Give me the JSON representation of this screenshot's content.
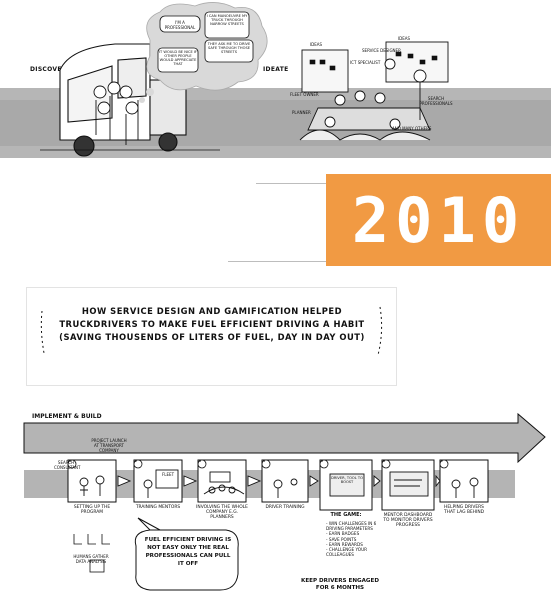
{
  "top": {
    "discover": "DISCOVER",
    "ideate": "IDEATE",
    "bubbles": [
      "I'M A PROFESSIONAL",
      "I CAN MANOEUVRE MY TRUCK THROUGH NARROW STREETS",
      "THEY ASK ME TO DRIVE SAFE THROUGH THOSE STREETS",
      "IT WOULD BE NICE IF OTHER PEOPLE WOULD APPRECIATE THAT"
    ],
    "ideate_labels": [
      "IDEAS",
      "IDEAS",
      "FLEET OWNER",
      "PLANNER",
      "ICT SPECIALIST",
      "SERVICE DESIGNER",
      "SEARCH PROFESSIONALS",
      "AND MANY OTHERS"
    ]
  },
  "year": "2010",
  "headline": "How service design and gamification helped truckdrivers to make fuel efficient driving a habit (saving thousends of liters of fuel, day in day out)",
  "bottom": {
    "section_title": "IMPLEMENT & BUILD",
    "steps": [
      {
        "num": "1",
        "label": "SETTING UP THE PROGRAM"
      },
      {
        "num": "2",
        "label": "TRAINING MENTORS"
      },
      {
        "num": "3",
        "label": "INVOLVING THE WHOLE COMPANY E.G. PLANNERS"
      },
      {
        "num": "4",
        "label": "DRIVER TRAINING"
      },
      {
        "num": "5",
        "label": "THE GAME:"
      },
      {
        "num": "6",
        "label": "MENTOR DASHBOARD TO MONITOR DRIVERS PROGRESS"
      },
      {
        "num": "7",
        "label": "HELPING DRIVERS THAT LAG BEHIND"
      }
    ],
    "annot_project": "PROJECT LAUNCH AT TRANSPORT COMPANY",
    "annot_search": "SEARCH CONSULTANT",
    "annot_humans": "HUMANS GATHER DATA ANALYSIS",
    "fleet_sign": "FLEET",
    "game_screen": "DRIVER, TOOL TO BOOST",
    "game_list": [
      "- WIN CHALLENGES IN 6 DRIVING PARAMETERS",
      "- EARN BADGES",
      "- SAVE POINTS",
      "- EARN REWARDS",
      "- CHALLENGE YOUR COLLEAGUES"
    ],
    "engaged": "KEEP DRIVERS ENGAGED FOR 6 MONTHS",
    "speech_bubble": "FUEL EFFICIENT DRIVING IS NOT EASY ONLY THE REAL PROFESSIONALS CAN PULL IT OFF"
  }
}
